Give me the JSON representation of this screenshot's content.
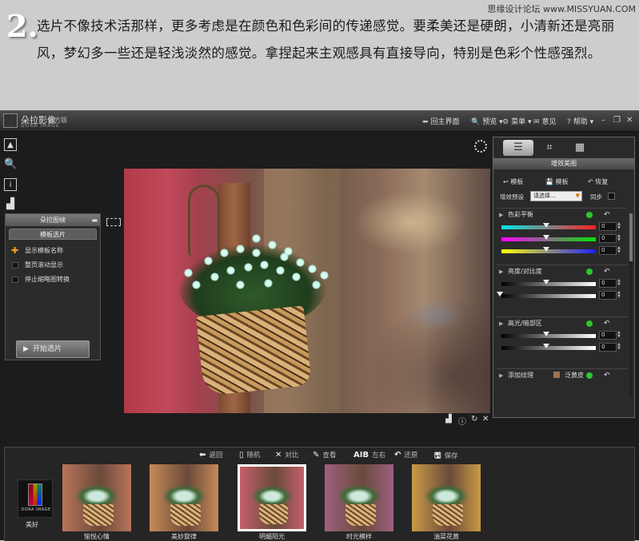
{
  "tutorial": {
    "step_number": "2.",
    "text": "选片不像技术活那样，更多考虑是在颜色和色彩间的传递感觉。要柔美还是硬朗，小清新还是亮丽风，梦幻多一些还是轻浅淡然的感觉。拿捏起来主观感具有直接导向，特别是色彩个性感强烈。",
    "watermark": "思缘设计论坛 www.MISSYUAN.COM"
  },
  "app": {
    "name": "朵拉影像",
    "sub_name": "DORA IMAGE",
    "edition": "官方版",
    "toolbar": {
      "home": "回主界面",
      "preview": "预览",
      "menu": "菜单",
      "feedback": "意见",
      "help": "帮助"
    }
  },
  "template_panel": {
    "title": "朵拉图帧",
    "tab": "模板选片",
    "options": [
      {
        "label": "显示模板名称",
        "checked": true
      },
      {
        "label": "整页滚动显示",
        "checked": false
      },
      {
        "label": "停止缩略图转换",
        "checked": false
      }
    ],
    "start_button": "开始选片"
  },
  "right_panel": {
    "title": "增效美图",
    "btn_template_apply": "模板",
    "btn_template_save": "模板",
    "btn_restore": "恢复",
    "preset_label": "增效预设",
    "preset_value": "请选择...",
    "sync_label": "同步",
    "sections": {
      "color_balance": {
        "title": "色彩平衡",
        "values": [
          "0",
          "0",
          "0"
        ]
      },
      "brightness_contrast": {
        "title": "亮度/对比度",
        "values": [
          "0",
          "0"
        ]
      },
      "highlight_shadow": {
        "title": "高光/暗部区",
        "values": [
          "0",
          "0"
        ]
      },
      "texture": {
        "title": "添加纹理",
        "value": "泛黄皮"
      }
    }
  },
  "strip": {
    "toolbar": {
      "back": "返回",
      "random": "随机",
      "compare": "对比",
      "view": "查看",
      "ab_glyph": "AIB",
      "side_by_side": "左右",
      "restore": "还原",
      "save": "保存"
    },
    "dora_tile_text": "DORA IMAGE",
    "dora_label": "美好",
    "thumbnails": [
      {
        "label": "愉悦心情",
        "tint": "#b8745a",
        "selected": false
      },
      {
        "label": "美妙旋律",
        "tint": "#c58a58",
        "selected": false
      },
      {
        "label": "明媚阳光",
        "tint": "#c2606a",
        "selected": true
      },
      {
        "label": "时光模样",
        "tint": "#9d6080",
        "selected": false
      },
      {
        "label": "油菜花黄",
        "tint": "#c99a45",
        "selected": false
      }
    ]
  },
  "colors": {
    "accent_green": "#2ec52e",
    "accent_orange": "#f0a020"
  }
}
